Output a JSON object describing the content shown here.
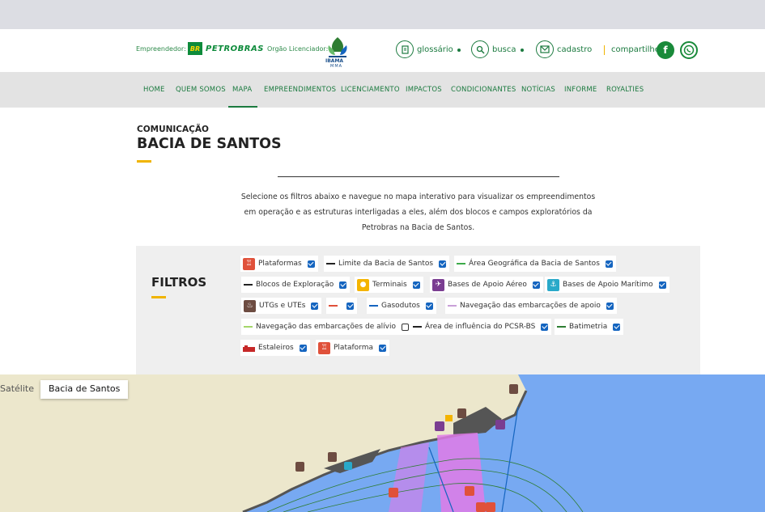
{
  "header": {
    "empreendedor_label": "Empreendedor:",
    "petrobras_badge": "BR",
    "petrobras_name": "PETROBRAS",
    "orgao_label": "Orgão Licenciador:",
    "ibama_text": "IBAMA",
    "mma_text": "MMA",
    "links": [
      {
        "label": "glossário",
        "icon": "book-icon"
      },
      {
        "label": "busca",
        "icon": "search-icon"
      },
      {
        "label": "cadastro",
        "icon": "mail-icon"
      }
    ],
    "share_label": "compartilhe",
    "facebook_glyph": "f",
    "brand_green": "#1b7a3f",
    "accent_yellow": "#f0b400"
  },
  "nav": {
    "items": [
      "HOME",
      "QUEM SOMOS",
      "MAPA",
      "EMPREENDIMENTOS",
      "LICENCIAMENTO",
      "IMPACTOS",
      "CONDICIONANTES",
      "NOTÍCIAS",
      "INFORME",
      "ROYALTIES"
    ],
    "active": "MAPA"
  },
  "page": {
    "kicker": "COMUNICAÇÃO",
    "title": "BACIA DE SANTOS",
    "intro": "Selecione os filtros abaixo e navegue no mapa interativo para visualizar os empreendimentos em operação e as estruturas interligadas a eles, além dos blocos e campos exploratórios da Petrobras na Bacia de Santos."
  },
  "filters": {
    "title": "FILTROS",
    "items": [
      {
        "label": "Plataformas",
        "checked": true,
        "icon": "platform-icon",
        "color": "#e0513a"
      },
      {
        "label": "Limite da Bacia de Santos",
        "checked": true,
        "icon": "line-icon",
        "color": "#222222"
      },
      {
        "label": "Área Geográfica da Bacia de Santos",
        "checked": true,
        "icon": "line-icon",
        "color": "#3dab4a"
      },
      {
        "label": "Blocos de Exploração",
        "checked": true,
        "icon": "line-icon",
        "color": "#222222"
      },
      {
        "label": "Terminais",
        "checked": true,
        "icon": "terminal-icon",
        "color": "#f4b400"
      },
      {
        "label": "Bases de Apoio Aéreo",
        "checked": true,
        "icon": "air-base-icon",
        "color": "#7a3d91"
      },
      {
        "label": "Bases de Apoio Marítimo",
        "checked": true,
        "icon": "sea-base-icon",
        "color": "#29a9c9"
      },
      {
        "label": "UTGs e UTEs",
        "checked": true,
        "icon": "utg-icon",
        "color": "#6d4c41"
      },
      {
        "label": "",
        "checked": true,
        "icon": "line-icon",
        "color": "#e0513a"
      },
      {
        "label": "Gasodutos",
        "checked": true,
        "icon": "line-icon",
        "color": "#1565c0"
      },
      {
        "label": "Navegação das embarcações de apoio",
        "checked": true,
        "icon": "line-icon",
        "color": "#c9a0d8"
      },
      {
        "label": "Navegação das embarcações de alívio",
        "checked": false,
        "icon": "line-icon",
        "color": "#a5d66a"
      },
      {
        "label": "Área de influência do PCSR-BS",
        "checked": true,
        "icon": "line-icon",
        "color": "#222222"
      },
      {
        "label": "Batimetria",
        "checked": true,
        "icon": "line-icon",
        "color": "#2e7d32"
      },
      {
        "label": "Estaleiros",
        "checked": true,
        "icon": "shipyard-icon",
        "color": "#c62828"
      },
      {
        "label": "Plataforma",
        "checked": true,
        "icon": "platform-icon",
        "color": "#e0513a"
      }
    ]
  },
  "map": {
    "tabs": [
      "Satélite",
      "Bacia de Santos"
    ],
    "active_tab": "Bacia de Santos",
    "colors": {
      "ocean": "#77a9f2",
      "land": "#ece7cc",
      "coast": "#555555",
      "route": "#e07be8"
    }
  }
}
